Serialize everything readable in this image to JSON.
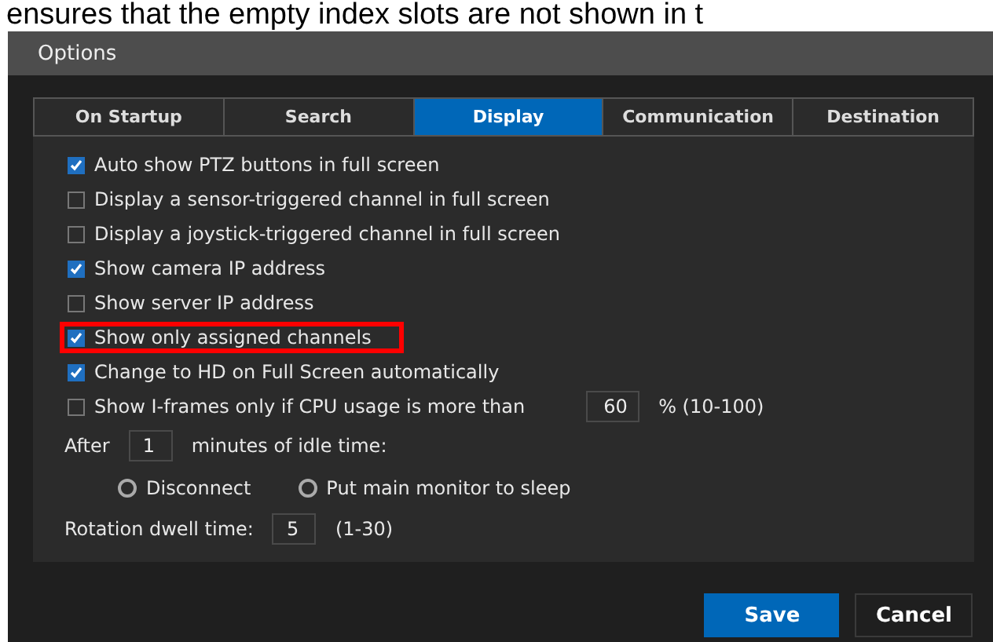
{
  "caption": "ensures that the empty index slots are not shown in t",
  "window": {
    "title": "Options"
  },
  "tabs": [
    {
      "label": "On Startup",
      "selected": false
    },
    {
      "label": "Search",
      "selected": false
    },
    {
      "label": "Display",
      "selected": true
    },
    {
      "label": "Communication",
      "selected": false
    },
    {
      "label": "Destination",
      "selected": false
    }
  ],
  "options": [
    {
      "kind": "checkbox",
      "label": "Auto show PTZ buttons in full screen",
      "checked": true,
      "highlighted": false
    },
    {
      "kind": "checkbox",
      "label": "Display a sensor-triggered channel in full screen",
      "checked": false,
      "highlighted": false
    },
    {
      "kind": "checkbox",
      "label": "Display a joystick-triggered channel in full screen",
      "checked": false,
      "highlighted": false
    },
    {
      "kind": "checkbox",
      "label": "Show camera IP address",
      "checked": true,
      "highlighted": false
    },
    {
      "kind": "checkbox",
      "label": "Show server IP address",
      "checked": false,
      "highlighted": false
    },
    {
      "kind": "checkbox",
      "label": "Show only assigned channels",
      "checked": true,
      "highlighted": true
    },
    {
      "kind": "checkbox",
      "label": "Change to HD on Full Screen automatically",
      "checked": true,
      "highlighted": false
    },
    {
      "kind": "checkbox_input",
      "label": "Show I-frames only if CPU usage is more than",
      "checked": false,
      "highlighted": false,
      "value": "60",
      "suffix": "% (10-100)"
    },
    {
      "kind": "input",
      "label": "After",
      "value": "1",
      "suffix": "minutes of idle time:"
    },
    {
      "kind": "radios",
      "choices": [
        {
          "label": "Disconnect",
          "selected": false
        },
        {
          "label": "Put main monitor to sleep",
          "selected": false
        }
      ]
    },
    {
      "kind": "input",
      "label": "Rotation dwell time:",
      "value": "5",
      "suffix": "(1-30)"
    }
  ],
  "buttons": [
    {
      "label": "Save",
      "kind": "primary"
    },
    {
      "label": "Cancel",
      "kind": "secondary"
    }
  ]
}
